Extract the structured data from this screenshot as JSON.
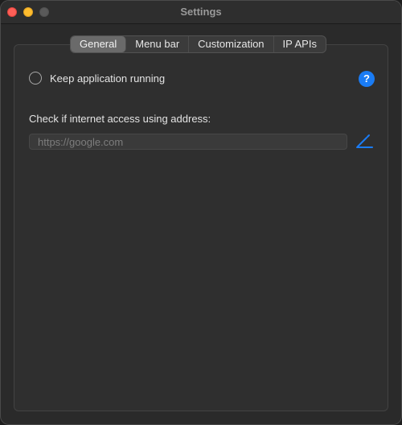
{
  "window": {
    "title": "Settings"
  },
  "tabs": [
    {
      "label": "General",
      "active": true
    },
    {
      "label": "Menu bar",
      "active": false
    },
    {
      "label": "Customization",
      "active": false
    },
    {
      "label": "IP APIs",
      "active": false
    }
  ],
  "general": {
    "keep_running_label": "Keep application running",
    "keep_running_checked": false,
    "help_glyph": "?",
    "address_label": "Check if internet access using address:",
    "address_value": "",
    "address_placeholder": "https://google.com",
    "edit_icon": "pencil-edit-icon"
  },
  "colors": {
    "accent": "#1a7cf5",
    "close": "#fe5f57",
    "minimize": "#febc2e",
    "zoom_disabled": "#5a5a5a"
  }
}
